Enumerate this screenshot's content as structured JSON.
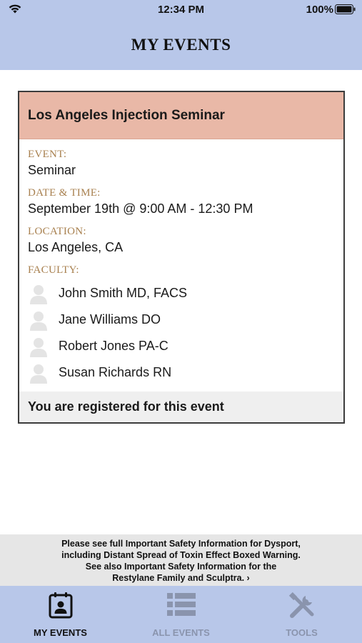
{
  "status_bar": {
    "time": "12:34 PM",
    "battery": "100%"
  },
  "header": {
    "title": "MY EVENTS"
  },
  "event": {
    "title": "Los Angeles Injection Seminar",
    "event_label": "EVENT:",
    "event_value": "Seminar",
    "datetime_label": "DATE & TIME:",
    "datetime_value": "September 19th @ 9:00 AM - 12:30 PM",
    "location_label": "LOCATION:",
    "location_value": "Los Angeles, CA",
    "faculty_label": "FACULTY:",
    "faculty": [
      {
        "name": "John Smith MD, FACS"
      },
      {
        "name": "Jane Williams DO"
      },
      {
        "name": "Robert Jones PA-C"
      },
      {
        "name": "Susan Richards RN"
      }
    ],
    "registration_status": "You are registered for this event"
  },
  "safety": {
    "line1": "Please see full Important Safety Information for Dysport,",
    "line2": "including Distant Spread of Toxin Effect Boxed Warning.",
    "line3": "See also Important Safety Information for the",
    "line4": "Restylane Family and Sculptra. ›"
  },
  "tabs": [
    {
      "label": "MY EVENTS",
      "icon": "calendar-person-icon",
      "active": true
    },
    {
      "label": "ALL EVENTS",
      "icon": "list-icon",
      "active": false
    },
    {
      "label": "TOOLS",
      "icon": "tools-icon",
      "active": false
    }
  ],
  "colors": {
    "nav_background": "#b8c7e9",
    "card_header": "#e9b8a7",
    "label_color": "#a8804f",
    "inactive_tab": "#8a94ad"
  }
}
